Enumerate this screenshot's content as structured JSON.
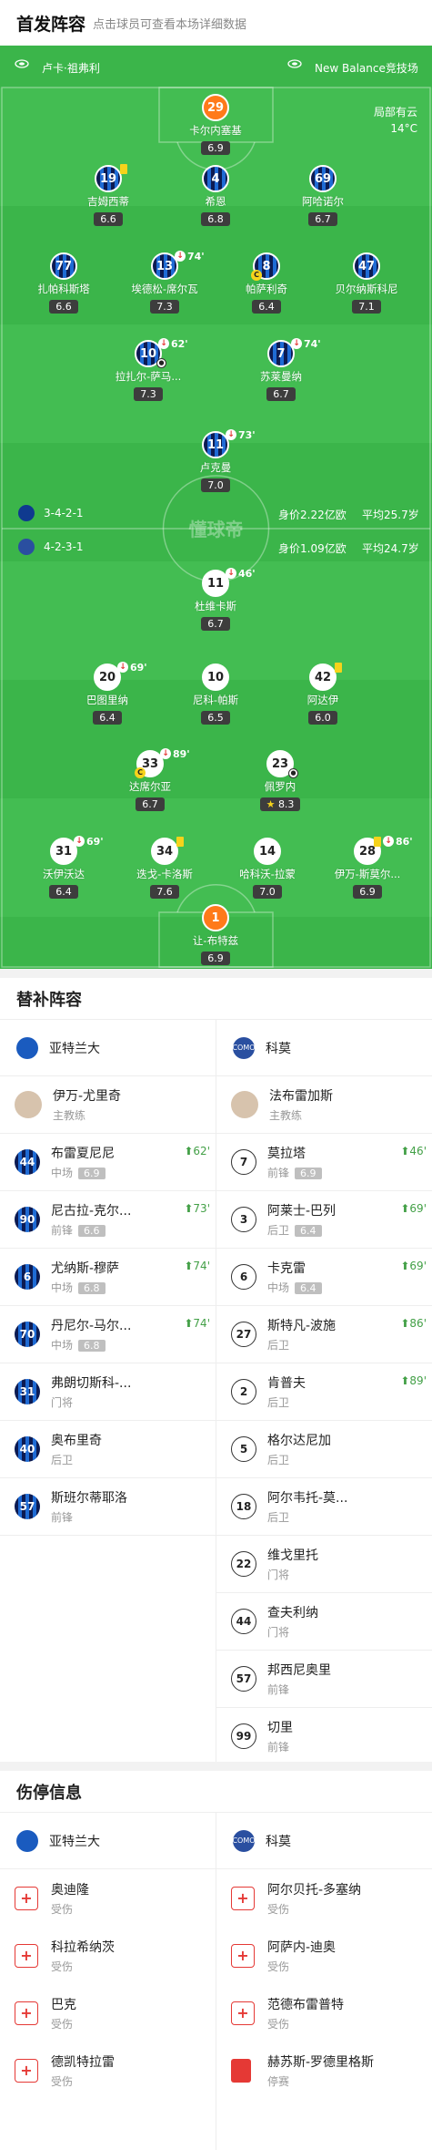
{
  "header": {
    "title": "首发阵容",
    "subtitle": "点击球员可查看本场详细数据"
  },
  "pitch": {
    "stadium": "卢卡·祖弗利",
    "away_stadium_label": "New Balance竞技场",
    "weather": "局部有云",
    "temperature": "14°C",
    "watermark": "懂球帝",
    "home": {
      "formation": "3-4-2-1",
      "value": "身价2.22亿欧",
      "age": "平均25.7岁"
    },
    "away": {
      "formation": "4-2-3-1",
      "value": "身价1.09亿欧",
      "age": "平均24.7岁"
    }
  },
  "home_players": [
    {
      "num": "29",
      "name": "卡尔内塞基",
      "rating": "6.9"
    },
    {
      "num": "19",
      "name": "吉姆西蒂",
      "rating": "6.6"
    },
    {
      "num": "4",
      "name": "希恩",
      "rating": "6.8"
    },
    {
      "num": "69",
      "name": "阿哈诺尔",
      "rating": "6.7"
    },
    {
      "num": "77",
      "name": "扎帕科斯塔",
      "rating": "6.6"
    },
    {
      "num": "13",
      "name": "埃德松-席尔瓦",
      "rating": "7.3",
      "sub": "74'"
    },
    {
      "num": "8",
      "name": "帕萨利奇",
      "rating": "6.4"
    },
    {
      "num": "47",
      "name": "贝尔纳斯科尼",
      "rating": "7.1"
    },
    {
      "num": "10",
      "name": "拉扎尔-萨马...",
      "rating": "7.3",
      "sub": "62'"
    },
    {
      "num": "7",
      "name": "苏莱曼纳",
      "rating": "6.7",
      "sub": "74'"
    },
    {
      "num": "11",
      "name": "卢克曼",
      "rating": "7.0",
      "sub": "73'"
    }
  ],
  "away_players": [
    {
      "num": "11",
      "name": "杜维卡斯",
      "rating": "6.7",
      "sub": "46'"
    },
    {
      "num": "20",
      "name": "巴图里纳",
      "rating": "6.4",
      "sub": "69'"
    },
    {
      "num": "10",
      "name": "尼科-帕斯",
      "rating": "6.5"
    },
    {
      "num": "42",
      "name": "阿达伊",
      "rating": "6.0"
    },
    {
      "num": "33",
      "name": "达席尔亚",
      "rating": "6.7",
      "sub": "89'"
    },
    {
      "num": "23",
      "name": "佩罗内",
      "rating": "8.3"
    },
    {
      "num": "31",
      "name": "沃伊沃达",
      "rating": "6.4",
      "sub": "69'"
    },
    {
      "num": "34",
      "name": "迭戈-卡洛斯",
      "rating": "7.6"
    },
    {
      "num": "14",
      "name": "哈科沃-拉蒙",
      "rating": "7.0"
    },
    {
      "num": "28",
      "name": "伊万-斯莫尔...",
      "rating": "6.9",
      "sub": "86'"
    },
    {
      "num": "1",
      "name": "让-布特兹",
      "rating": "6.9"
    }
  ],
  "subs": {
    "title": "替补阵容",
    "home_team": "亚特兰大",
    "away_team": "科莫",
    "home_coach": {
      "name": "伊万-尤里奇",
      "role": "主教练"
    },
    "away_coach": {
      "name": "法布雷加斯",
      "role": "主教练"
    },
    "home": [
      {
        "num": "44",
        "name": "布雷夏尼尼",
        "pos": "中场",
        "rating": "6.9",
        "in": "62'"
      },
      {
        "num": "90",
        "name": "尼古拉-克尔...",
        "pos": "前锋",
        "rating": "6.6",
        "in": "73'"
      },
      {
        "num": "6",
        "name": "尤纳斯-穆萨",
        "pos": "中场",
        "rating": "6.8",
        "in": "74'"
      },
      {
        "num": "70",
        "name": "丹尼尔-马尔...",
        "pos": "中场",
        "rating": "6.8",
        "in": "74'"
      },
      {
        "num": "31",
        "name": "弗朗切斯科-...",
        "pos": "门将"
      },
      {
        "num": "40",
        "name": "奥布里奇",
        "pos": "后卫"
      },
      {
        "num": "57",
        "name": "斯班尔蒂耶洛",
        "pos": "前锋"
      }
    ],
    "away": [
      {
        "num": "7",
        "name": "莫拉塔",
        "pos": "前锋",
        "rating": "6.9",
        "in": "46'"
      },
      {
        "num": "3",
        "name": "阿莱士-巴列",
        "pos": "后卫",
        "rating": "6.4",
        "in": "69'"
      },
      {
        "num": "6",
        "name": "卡克雷",
        "pos": "中场",
        "rating": "6.4",
        "in": "69'"
      },
      {
        "num": "27",
        "name": "斯特凡-波施",
        "pos": "后卫",
        "in": "86'"
      },
      {
        "num": "2",
        "name": "肯普夫",
        "pos": "后卫",
        "in": "89'"
      },
      {
        "num": "5",
        "name": "格尔达尼加",
        "pos": "后卫"
      },
      {
        "num": "18",
        "name": "阿尔韦托-莫...",
        "pos": "后卫"
      },
      {
        "num": "22",
        "name": "维戈里托",
        "pos": "门将"
      },
      {
        "num": "44",
        "name": "查夫利纳",
        "pos": "门将"
      },
      {
        "num": "57",
        "name": "邦西尼奥里",
        "pos": "前锋"
      },
      {
        "num": "99",
        "name": "切里",
        "pos": "前锋"
      }
    ]
  },
  "injuries": {
    "title": "伤停信息",
    "home_team": "亚特兰大",
    "away_team": "科莫",
    "home": [
      {
        "name": "奥迪隆",
        "status": "受伤"
      },
      {
        "name": "科拉希纳茨",
        "status": "受伤"
      },
      {
        "name": "巴克",
        "status": "受伤"
      },
      {
        "name": "德凯特拉雷",
        "status": "受伤"
      }
    ],
    "away": [
      {
        "name": "阿尔贝托-多塞纳",
        "status": "受伤",
        "type": "injury"
      },
      {
        "name": "阿萨内-迪奥",
        "status": "受伤",
        "type": "injury"
      },
      {
        "name": "范德布雷普特",
        "status": "受伤",
        "type": "injury"
      },
      {
        "name": "赫苏斯-罗德里格斯",
        "status": "停赛",
        "type": "suspension"
      }
    ]
  }
}
